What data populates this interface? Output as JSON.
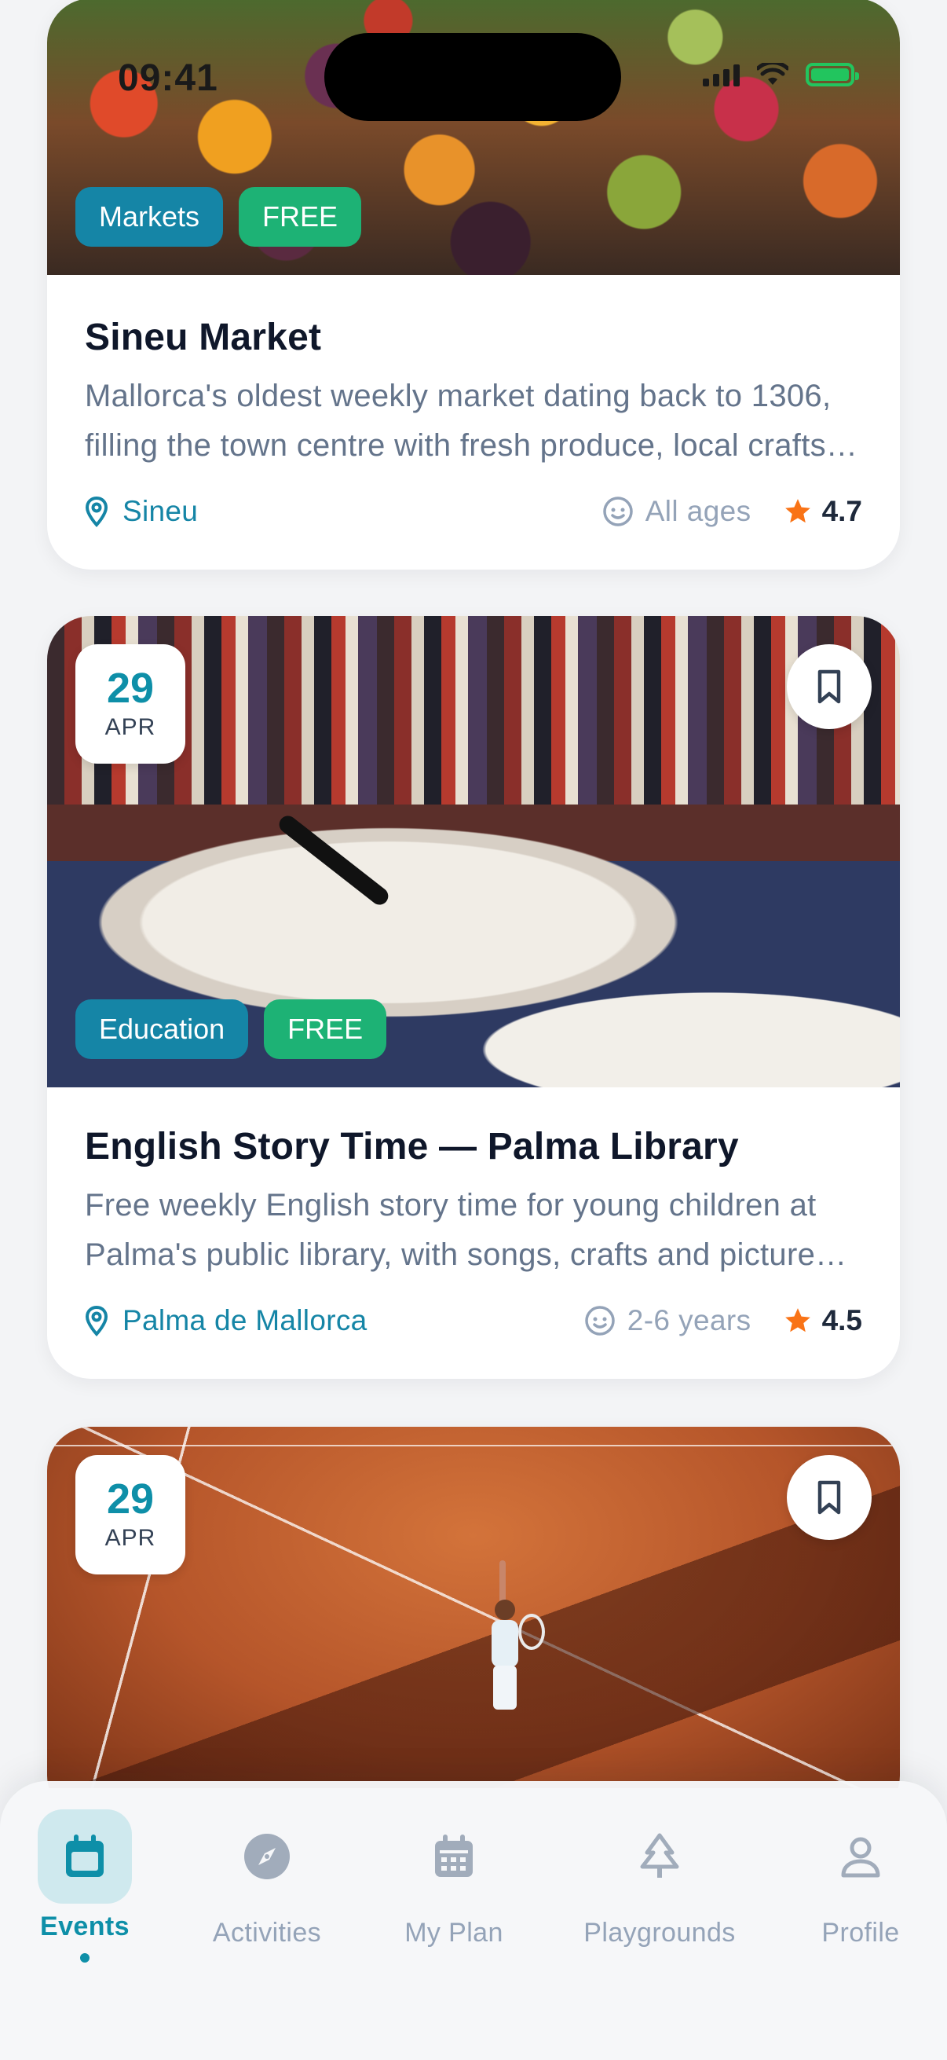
{
  "status_bar": {
    "time": "09:41"
  },
  "events": [
    {
      "title": "Sineu Market",
      "description": "Mallorca's oldest weekly market dating back to 1306, filling the town centre with fresh produce, local crafts and livestock.",
      "category": "Markets",
      "price": "FREE",
      "location": "Sineu",
      "ages": "All ages",
      "rating": "4.7"
    },
    {
      "date_day": "29",
      "date_month": "APR",
      "title": "English Story Time — Palma Library",
      "description": "Free weekly English story time for young children at Palma's public library, with songs, crafts and picture books.",
      "category": "Education",
      "price": "FREE",
      "location": "Palma de Mallorca",
      "ages": "2-6 years",
      "rating": "4.5"
    },
    {
      "date_day": "29",
      "date_month": "APR"
    }
  ],
  "nav": {
    "items": [
      {
        "label": "Events",
        "icon": "calendar-icon",
        "active": true
      },
      {
        "label": "Activities",
        "icon": "compass-icon"
      },
      {
        "label": "My Plan",
        "icon": "calendar-grid-icon"
      },
      {
        "label": "Playgrounds",
        "icon": "tree-icon"
      },
      {
        "label": "Profile",
        "icon": "person-icon"
      }
    ]
  },
  "colors": {
    "accent": "#0e8fa8",
    "category_tag": "#1585a6",
    "free_tag": "#1db275",
    "rating_star": "#f97316"
  }
}
